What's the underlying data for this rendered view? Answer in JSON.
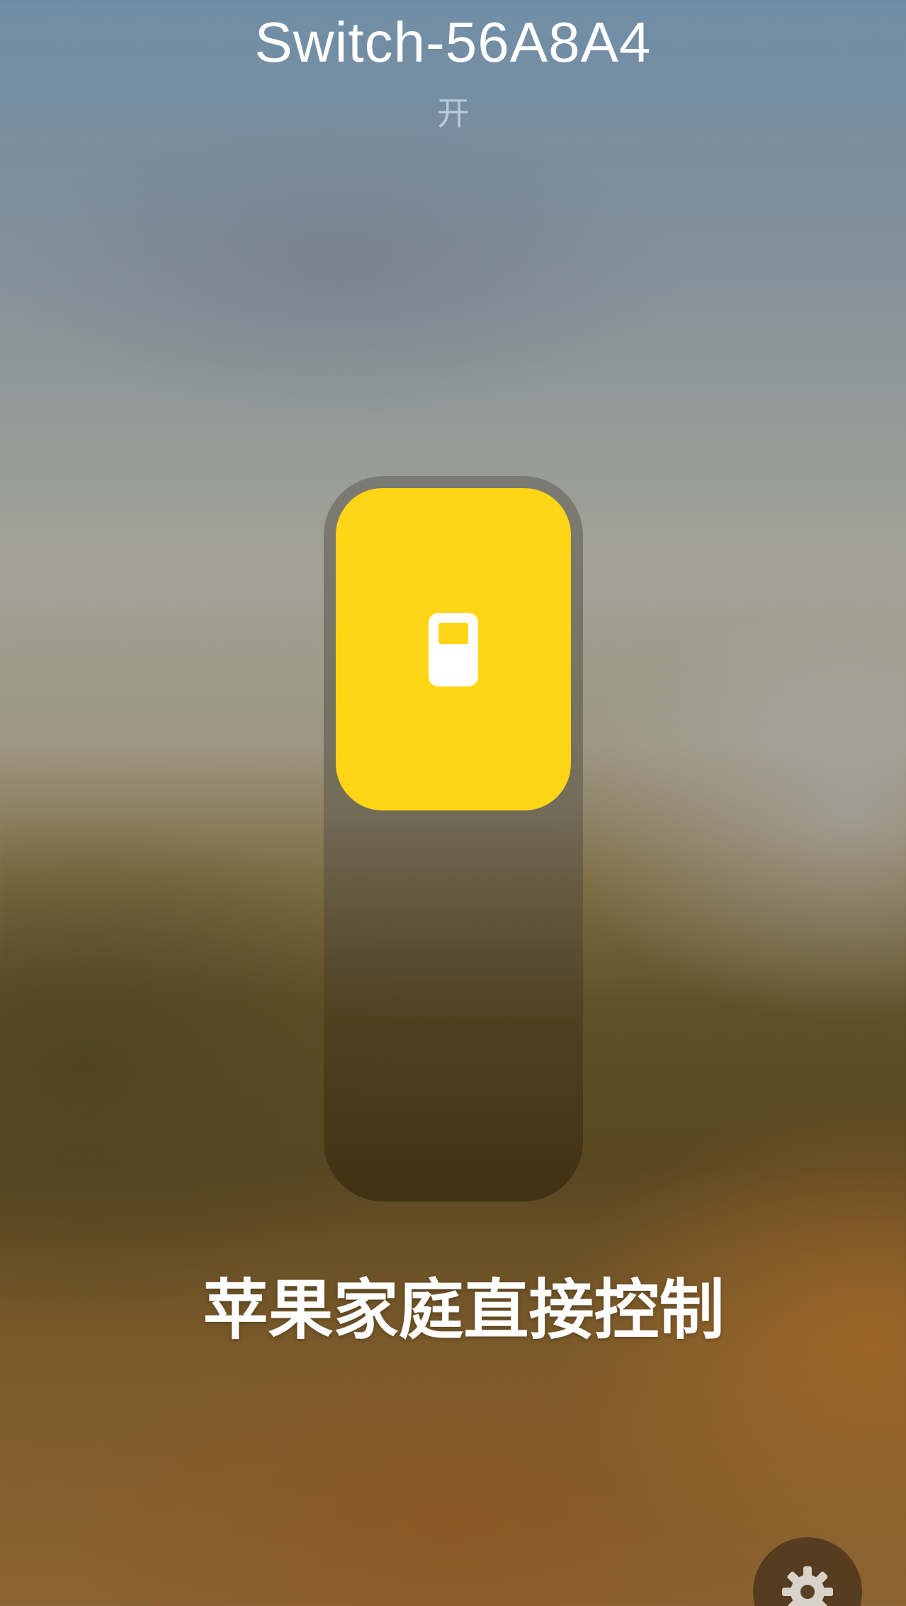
{
  "header": {
    "title": "Switch-56A8A4",
    "status": "开"
  },
  "control": {
    "type": "vertical-slider",
    "level": 0.46,
    "accent_color": "#ffd515",
    "icon": "switch-icon"
  },
  "caption": "苹果家庭直接控制",
  "settings": {
    "icon": "gear-icon"
  }
}
